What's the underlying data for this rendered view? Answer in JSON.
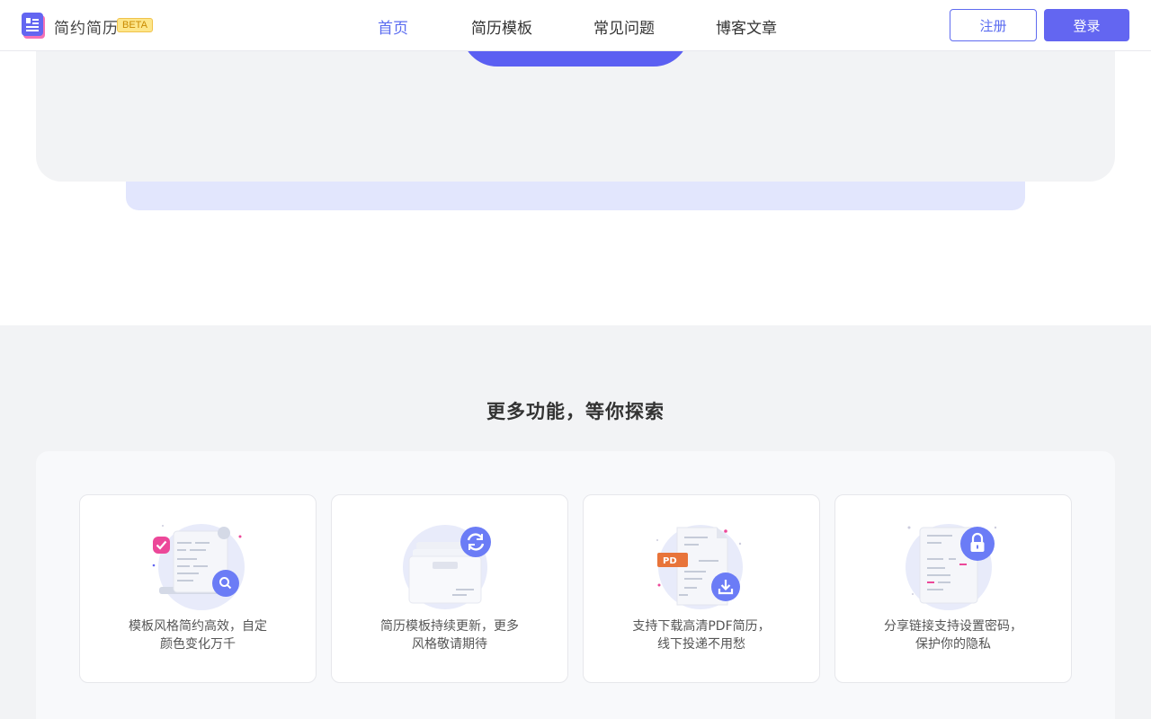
{
  "brand": {
    "name": "简约简历",
    "badge": "BETA"
  },
  "nav": {
    "items": [
      {
        "label": "首页",
        "active": true
      },
      {
        "label": "简历模板",
        "active": false
      },
      {
        "label": "常见问题",
        "active": false
      },
      {
        "label": "博客文章",
        "active": false
      }
    ]
  },
  "auth": {
    "register": "注册",
    "login": "登录"
  },
  "features": {
    "title": "更多功能，等你探索",
    "cards": [
      {
        "line1": "模板风格简约高效，自定",
        "line2": "颜色变化万千",
        "icon": "template-search-icon"
      },
      {
        "line1": "简历模板持续更新，更多",
        "line2": "风格敬请期待",
        "icon": "refresh-folder-icon"
      },
      {
        "line1": "支持下载高清PDF简历，",
        "line2": "线下投递不用愁",
        "icon": "pdf-download-icon",
        "badge": "PD"
      },
      {
        "line1": "分享链接支持设置密码，",
        "line2": "保护你的隐私",
        "icon": "lock-share-icon"
      }
    ]
  },
  "colors": {
    "accent": "#6366f1",
    "heroBg": "#f2f3f5",
    "strip": "#e2e6fd"
  }
}
